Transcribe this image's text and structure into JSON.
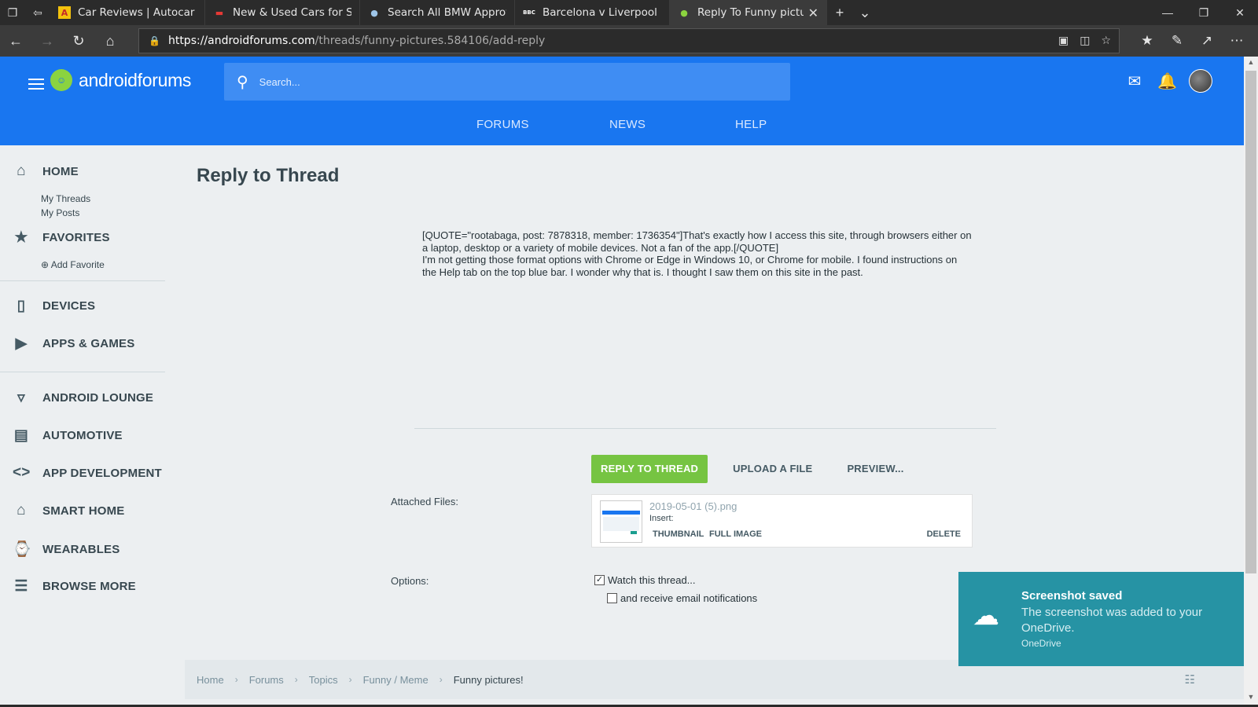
{
  "browser": {
    "tabs": [
      {
        "label": "Car Reviews | Autocar",
        "favicon": "A",
        "favicon_color": "#f4c20d"
      },
      {
        "label": "New & Used Cars for Sale -",
        "favicon": "▬",
        "favicon_color": "#e53935"
      },
      {
        "label": "Search All BMW Approved U",
        "favicon": "●",
        "favicon_color": "#9ec5e8"
      },
      {
        "label": "Barcelona v Liverpool live -",
        "favicon": "BBC",
        "favicon_color": "#ffffff"
      },
      {
        "label": "Reply To Funny pictures",
        "favicon": "●",
        "favicon_color": "#8bd33f"
      }
    ],
    "url_host": "https://androidforums.com",
    "url_path": "/threads/funny-pictures.584106/add-reply"
  },
  "header": {
    "logo_light": "android",
    "logo_bold": "forums",
    "search_placeholder": "Search...",
    "nav": [
      "FORUMS",
      "NEWS",
      "HELP"
    ]
  },
  "sidebar": {
    "home": "HOME",
    "my_threads": "My Threads",
    "my_posts": "My Posts",
    "favorites": "FAVORITES",
    "add_favorite": "⊕ Add Favorite",
    "devices": "DEVICES",
    "apps_games": "APPS & GAMES",
    "android_lounge": "ANDROID LOUNGE",
    "automotive": "AUTOMOTIVE",
    "app_development": "APP DEVELOPMENT",
    "smart_home": "SMART HOME",
    "wearables": "WEARABLES",
    "browse_more": "BROWSE MORE"
  },
  "main": {
    "title": "Reply to Thread",
    "editor_text_1": "[QUOTE=\"rootabaga, post: 7878318, member: 1736354\"]That's exactly how I access this site, through browsers either on a laptop, desktop or a variety of mobile devices. Not a fan of the app.[/QUOTE]",
    "editor_text_2": "I'm not getting those format options with Chrome or Edge in Windows 10, or Chrome for mobile. I found instructions on the Help tab on the top blue bar. I wonder why that is. I thought I saw them on this site in the past.",
    "reply_button": "REPLY TO THREAD",
    "upload_button": "UPLOAD A FILE",
    "preview_button": "PREVIEW...",
    "attached_label": "Attached Files:",
    "file": {
      "name": "2019-05-01 (5).png",
      "insert_label": "Insert:",
      "thumbnail": "THUMBNAIL",
      "full_image": "FULL IMAGE",
      "delete": "DELETE"
    },
    "options_label": "Options:",
    "watch_label": "Watch this thread...",
    "watch_checked": true,
    "email_label": "and receive email notifications",
    "email_checked": false
  },
  "breadcrumb": [
    "Home",
    "Forums",
    "Topics",
    "Funny / Meme",
    "Funny pictures!"
  ],
  "toast": {
    "title": "Screenshot saved",
    "message": "The screenshot was added to your OneDrive.",
    "source": "OneDrive"
  },
  "colors": {
    "brand_blue": "#1976f0",
    "accent_green": "#76c442",
    "toast_teal": "#2693a4"
  }
}
